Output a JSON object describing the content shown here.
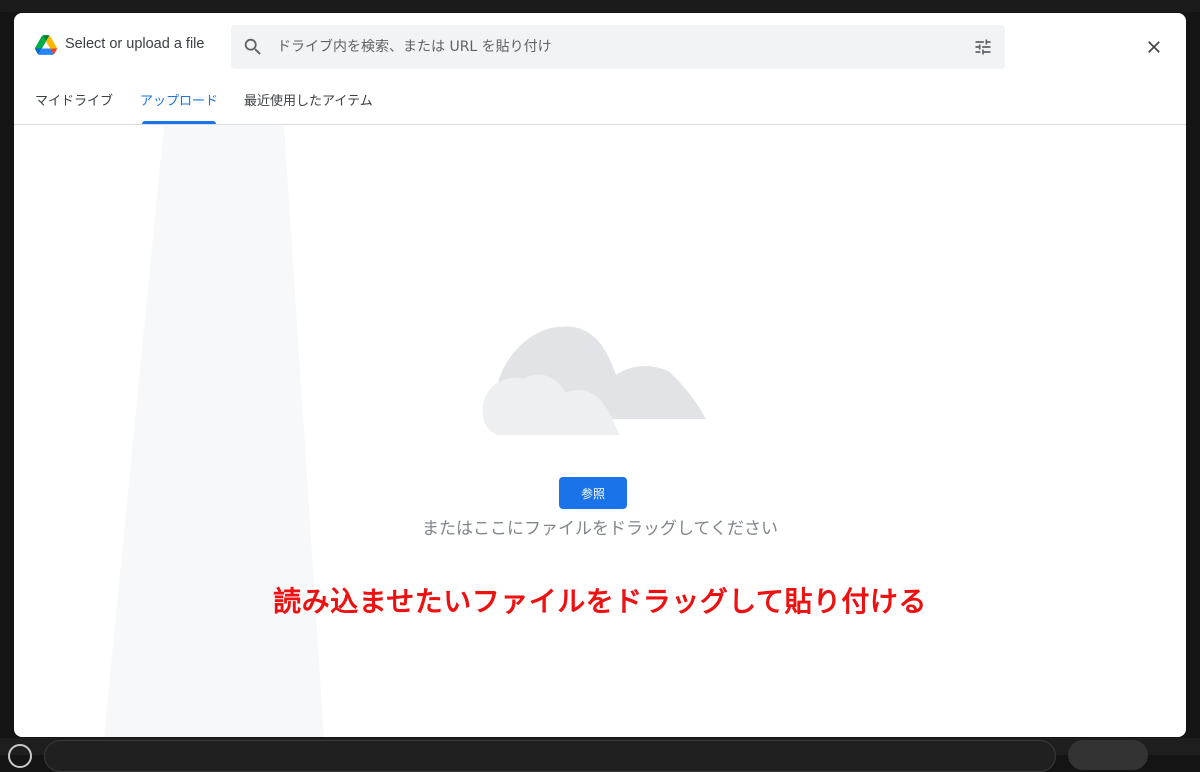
{
  "dialog": {
    "title": "Select or upload a file",
    "logo_icon": "google-drive-logo",
    "search": {
      "placeholder": "ドライブ内を検索、または URL を貼り付け",
      "value": "",
      "icon": "search-icon",
      "filter_icon": "tune-icon"
    },
    "close_icon": "close-icon",
    "tabs": [
      {
        "label": "マイドライブ",
        "active": false
      },
      {
        "label": "アップロード",
        "active": true
      },
      {
        "label": "最近使用したアイテム",
        "active": false
      }
    ],
    "upload": {
      "illustration_icon": "cloud-icon",
      "browse_label": "参照",
      "drop_hint": "またはここにファイルをドラッグしてください"
    }
  },
  "annotation": {
    "text": "読み込ませたいファイルをドラッグして貼り付ける",
    "color": "#ee1111"
  },
  "colors": {
    "accent": "#1a73e8",
    "search_bg": "#f1f3f4",
    "cloud": "#e1e3e6"
  }
}
